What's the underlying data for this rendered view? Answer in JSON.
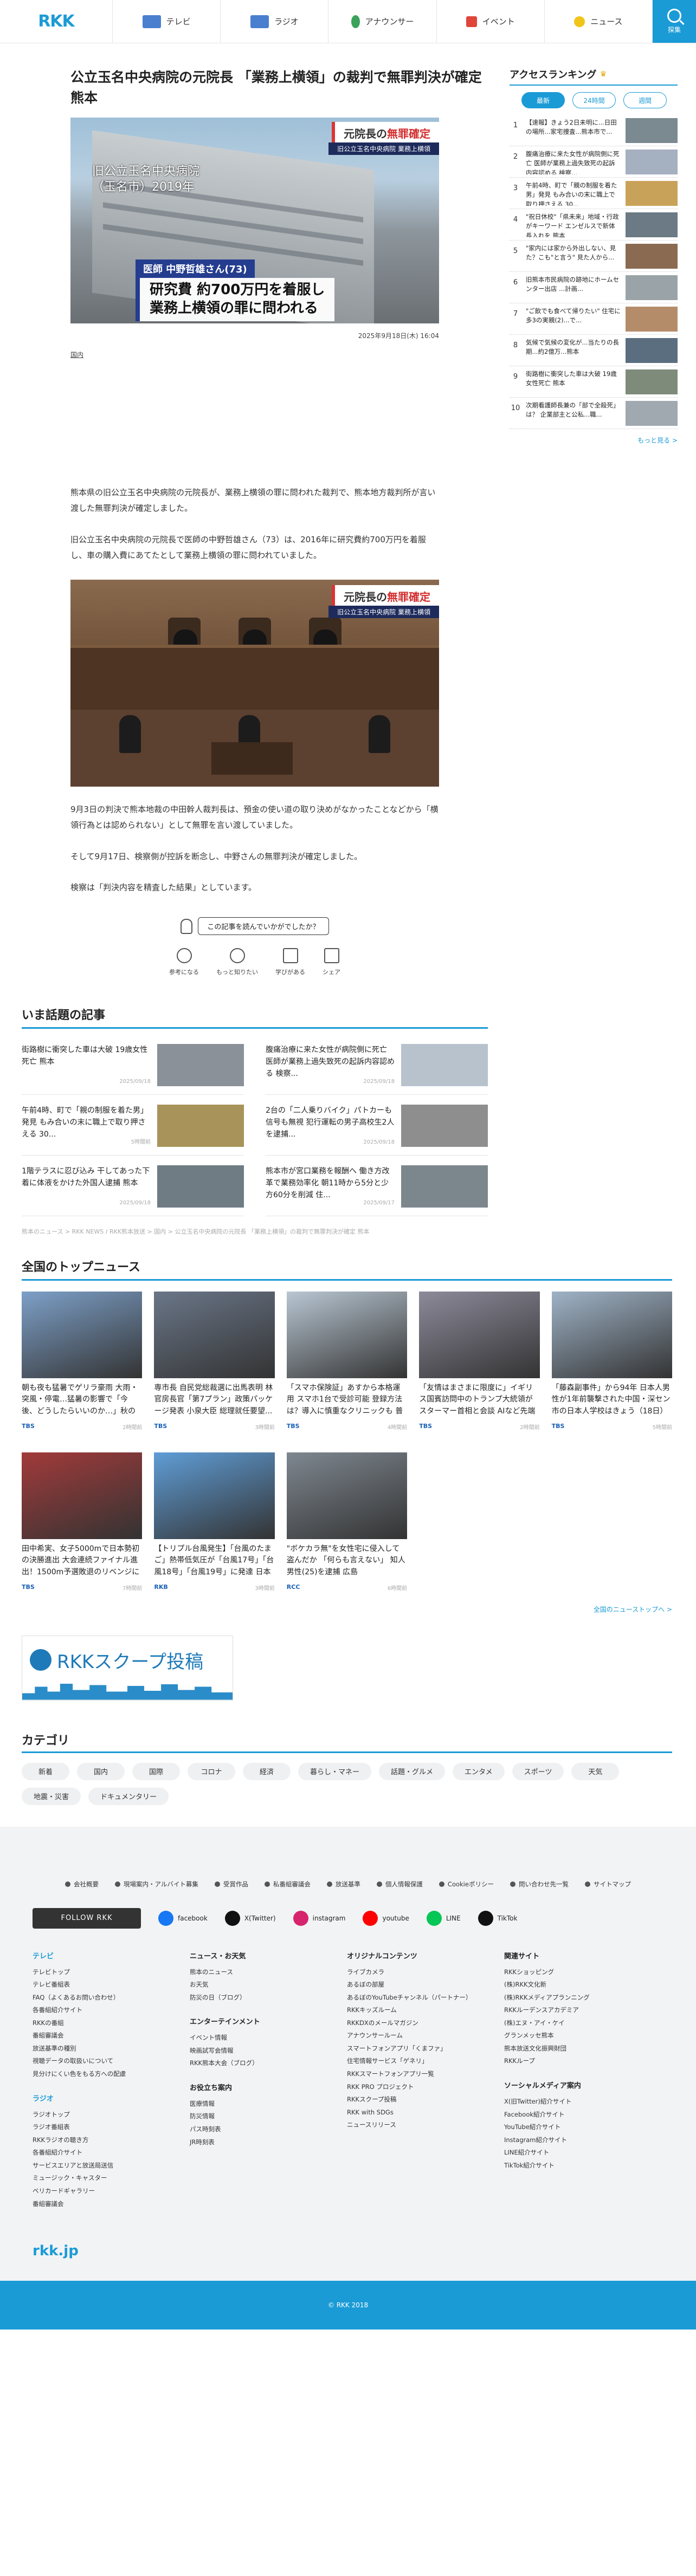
{
  "header": {
    "logo": "RKK",
    "nav": [
      {
        "label": "テレビ",
        "icon": "tv-icon",
        "color": "#4a7fd0"
      },
      {
        "label": "ラジオ",
        "icon": "radio-icon",
        "color": "#4a7fd0"
      },
      {
        "label": "アナウンサー",
        "icon": "announcer-icon",
        "color": "#3aa25a"
      },
      {
        "label": "イベント",
        "icon": "event-icon",
        "color": "#e0453a"
      },
      {
        "label": "ニュース",
        "icon": "news-icon",
        "color": "#f0c419"
      }
    ],
    "search_label": "探集"
  },
  "article": {
    "title": "公立玉名中央病院の元院長 「業務上横領」の裁判で無罪判決が確定 熊本",
    "hero": {
      "verdict_prefix": "元院長の",
      "verdict_red": "無罪確定",
      "verdict_sub": "旧公立玉名中央病院 業務上横領",
      "location": "旧公立玉名中央病院\n（玉名市）2019年",
      "caption_name": "医師 中野哲雄さん(73)",
      "caption_line1": "研究費 約700万円を着服し",
      "caption_line2": "業務上横領の罪に問われる"
    },
    "date": "2025年9月18日(木) 16:04",
    "category": "国内",
    "paragraphs": [
      "熊本県の旧公立玉名中央病院の元院長が、業務上横領の罪に問われた裁判で、熊本地方裁判所が言い渡した無罪判決が確定しました。",
      "旧公立玉名中央病院の元院長で医師の中野哲雄さん（73）は、2016年に研究費約700万円を着服し、車の購入費にあてたとして業務上横領の罪に問われていました。",
      "9月3日の判決で熊本地裁の中田幹人裁判長は、預金の使い道の取り決めがなかったことなどから「横領行為とは認められない」として無罪を言い渡していました。",
      "そして9月17日、検察側が控訴を断念し、中野さんの無罪判決が確定しました。",
      "検察は「判決内容を精査した結果」としています。"
    ],
    "court_image": {
      "verdict_prefix": "元院長の",
      "verdict_red": "無罪確定",
      "verdict_sub": "旧公立玉名中央病院 業務上横領"
    }
  },
  "feedback": {
    "question": "この記事を読んでいかがでしたか？",
    "reactions": [
      {
        "label": "参考になる",
        "icon": "lightbulb-icon"
      },
      {
        "label": "もっと知りたい",
        "icon": "magnifier-icon"
      },
      {
        "label": "学びがある",
        "icon": "book-icon"
      },
      {
        "label": "シェア",
        "icon": "share-icon"
      }
    ]
  },
  "ranking": {
    "title": "アクセスランキング",
    "tabs": [
      "最新",
      "24時間",
      "週間"
    ],
    "items": [
      {
        "num": "1",
        "text": "【速報】きょう2日未明に...日田の場所...家宅捜査...熊本市で...",
        "color": "#7a8a90"
      },
      {
        "num": "2",
        "text": "腹痛治療に来た女性が病院側に死亡 医師が業務上過失致死の起訴内容認める 検察...",
        "color": "#a5b0c0"
      },
      {
        "num": "3",
        "text": "午前4時、町で「親の制服を着た男」発見 もみ合いの末に職上で取り押さえる 30...",
        "color": "#c9a25a"
      },
      {
        "num": "4",
        "text": "\"祝日休校\"「県未来」地域・行政がキーワード エンゼルスで新体長入れを 熊本",
        "color": "#6b7a85"
      },
      {
        "num": "5",
        "text": "\"家内には家から外出しない、見た？こも\"と言う\" 見た人から...",
        "color": "#8a6a50"
      },
      {
        "num": "6",
        "text": "旧熊本市民病院の跡地にホームセンター出店 ...計画...",
        "color": "#9aa4a8"
      },
      {
        "num": "7",
        "text": "\"ご飲でも食べて帰りたい\" 住宅に多3の実親(2)...で...",
        "color": "#b58c6a"
      },
      {
        "num": "8",
        "text": "気候で気候の変化が...当たりの長期...約2億万...熊本",
        "color": "#5a6e80"
      },
      {
        "num": "9",
        "text": "街路樹に衝突した車は大破 19歳女性死亡 熊本",
        "color": "#7e8b7a"
      },
      {
        "num": "10",
        "text": "次期看護師長兼の「部で全殺死」は？ 企業部主と公私...職...",
        "color": "#a0a8b0"
      }
    ],
    "more": "もっと見る >"
  },
  "hot": {
    "title": "いま話題の記事",
    "items": [
      {
        "title": "街路樹に衝突した車は大破 19歳女性死亡 熊本",
        "date": "2025/09/18",
        "color": "#8a9198"
      },
      {
        "title": "腹痛治療に来た女性が病院側に死亡 医師が業務上過失致死の起訴内容認める 検察...",
        "date": "2025/09/18",
        "color": "#b7c2cd"
      },
      {
        "title": "午前4時、町で「親の制服を着た男」発見 もみ合いの末に職上で取り押さえる 30...",
        "date": "5時間前",
        "color": "#a8935a"
      },
      {
        "title": "2台の「二人乗りバイク」パトカーも信号も無視 犯行運転の男子高校生2人を逮捕...",
        "date": "2025/09/18",
        "color": "#8e8e8e"
      },
      {
        "title": "1階テラスに忍び込み 干してあった下着に体液をかけた外国人逮捕 熊本",
        "date": "2025/09/18",
        "color": "#6f7c84"
      },
      {
        "title": "熊本市が宮口業務を報酬へ 働き方改革で業務効率化 朝11時から5分と少方60分を削減 住...",
        "date": "2025/09/17",
        "color": "#7c878d"
      }
    ]
  },
  "breadcrumb": "熊本のニュース > RKK NEWS / RKK熊本放送 > 国内 > 公立玉名中央病院の元院長 「業務上横領」の裁判で無罪判決が確定 熊本",
  "top_news": {
    "title": "全国のトップニュース",
    "items": [
      {
        "title": "朝も夜も猛暑でゲリラ豪雨 大雨・突風・停電…猛暑の影響で「今後、どうしたらいいのか…」秋の訪れはい...",
        "src": "TBS",
        "date": "2時間前",
        "color": "#7da0c8"
      },
      {
        "title": "専市長 自民党総裁選に出馬表明 林官房長官「第7プラン」政策パッケージ発表 小泉大臣 総理就任要望...",
        "src": "TBS",
        "date": "3時間前",
        "color": "#6a7688"
      },
      {
        "title": "「スマホ保険証」あすから本格運用 スマホ1台で受診可能 登録方法は？導入に慎重なクリニックも 普及に課題",
        "src": "TBS",
        "date": "4時間前",
        "color": "#b9c7d3"
      },
      {
        "title": "「友情はまさまに限度に」イギリス国賓訪問中のトランプ大統領がスターマー首相と会談 AIなど先端技術分野...",
        "src": "TBS",
        "date": "2時間前",
        "color": "#8d8a9a"
      },
      {
        "title": "「藤森副事件」から94年 日本人男性が1年前襲撃された中国・深セン市の日本人学校はきょう（18日）あす休校...",
        "src": "TBS",
        "date": "5時間前",
        "color": "#9fb3c7"
      },
      {
        "title": "田中希実、女子5000mで日本勢初の決勝進出 大会連続ファイナル進出！1500m予選敗退のリベンジに国立競技場を歓喜...",
        "src": "TBS",
        "date": "7時間前",
        "color": "#a23a3a"
      },
      {
        "title": "【トリプル台風発生】「台風のたまご」熱帯低気圧が「台風17号」「台風18号」「台風19号」に発達 日本列島には...",
        "src": "RKB",
        "date": "3時間前",
        "color": "#5f9dd6"
      },
      {
        "title": "\"ボケカラ無\"を女性宅に侵入して盗んだか 「何らも言えない」 知人男性(25)を逮捕 広島",
        "src": "RCC",
        "date": "6時間前",
        "color": "#7e8790"
      }
    ],
    "more": "全国のニューストップへ >"
  },
  "banner": {
    "text": "RKKスクープ投稿"
  },
  "categories": {
    "title": "カテゴリ",
    "items": [
      "新着",
      "国内",
      "国際",
      "コロナ",
      "経済",
      "暮らし・マネー",
      "話題・グルメ",
      "エンタメ",
      "スポーツ",
      "天気",
      "地震・災害",
      "ドキュメンタリー"
    ]
  },
  "footer": {
    "links": [
      "会社概要",
      "現場案内・アルバイト募集",
      "受賞作品",
      "私番組審議会",
      "放送基準",
      "個人情報保護",
      "Cookieポリシー",
      "問い合わせ先一覧",
      "サイトマップ"
    ],
    "follow_label": "FOLLOW RKK",
    "sns": [
      {
        "label": "facebook",
        "color": "#1877f2"
      },
      {
        "label": "X(Twitter)",
        "color": "#111111"
      },
      {
        "label": "instagram",
        "color": "#d6246e"
      },
      {
        "label": "youtube",
        "color": "#ff0000"
      },
      {
        "label": "LINE",
        "color": "#06c755"
      },
      {
        "label": "TikTok",
        "color": "#111111"
      }
    ],
    "columns": [
      {
        "sections": [
          {
            "title": "テレビ",
            "blue": true,
            "items": [
              "テレビトップ",
              "テレビ番組表",
              "FAQ（よくあるお問い合わせ）",
              "各番組紹介サイト",
              "RKKの番組",
              "番組審議会",
              "放送基準の種別",
              "視聴データの取扱いについて",
              "見分けにくい色をもる方への配慮"
            ]
          },
          {
            "title": "ラジオ",
            "blue": true,
            "items": [
              "ラジオトップ",
              "ラジオ番組表",
              "RKKラジオの聴き方",
              "各番組紹介サイト",
              "サービスエリアと放送局送信",
              "ミュージック・キャスター",
              "ベリカードギャラリー",
              "番組審議会"
            ]
          }
        ]
      },
      {
        "sections": [
          {
            "title": "ニュース・お天気",
            "items": [
              "熊本のニュース",
              "お天気",
              "防災の日（ブログ）"
            ]
          },
          {
            "title": "エンターテインメント",
            "items": [
              "イベント情報",
              "映画試写会情報",
              "RKK熊本大会（ブログ）"
            ]
          },
          {
            "title": "お役立ち案内",
            "items": [
              "医療情報",
              "防災情報",
              "パス時刻表",
              "JR時刻表"
            ]
          }
        ]
      },
      {
        "sections": [
          {
            "title": "オリジナルコンテンツ",
            "items": [
              "ライブカメラ",
              "あるぼの部屋",
              "あるぼのYouTubeチャンネル（パートナー）",
              "RKKキッズルーム",
              "RKKDXのメールマガジン",
              "アナウンサールーム",
              "スマートフォンアプリ「くまファ」",
              "住宅情報サービス「ゲネリ」",
              "RKKスマートフォンアプリ一覧",
              "RKK PRO プロジェクト",
              "RKKスクープ投稿",
              "RKK with SDGs",
              "ニュースリリース"
            ]
          }
        ]
      },
      {
        "sections": [
          {
            "title": "関連サイト",
            "items": [
              "RKKショッピング",
              "(株)RKK文化新",
              "(株)RKKメディアプランニング",
              "RKKルーデンスアカデミア",
              "(株)エヌ・アイ・ケイ",
              "グランメッセ熊本",
              "熊本放送文化振興財団",
              "RKKループ"
            ]
          },
          {
            "title": "ソーシャルメディア案内",
            "items": [
              "X(旧Twitter)紹介サイト",
              "Facebook紹介サイト",
              "YouTube紹介サイト",
              "Instagram紹介サイト",
              "LINE紹介サイト",
              "TikTok紹介サイト"
            ]
          }
        ]
      }
    ],
    "bottom_logo": "rkk.jp",
    "copyright": "© RKK 2018"
  }
}
